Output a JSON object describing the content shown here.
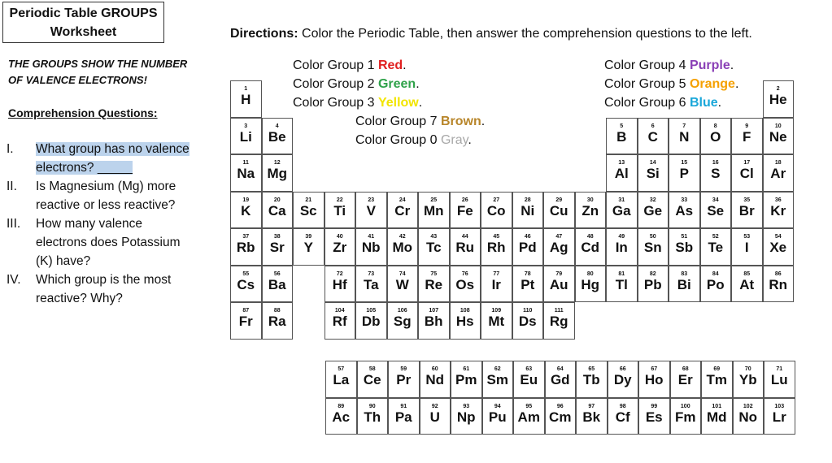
{
  "worksheet": {
    "title_line1": "Periodic Table GROUPS",
    "title_line2": "Worksheet",
    "directions_label": "Directions:",
    "directions_text": " Color the Periodic Table, then answer the comprehension questions to the left.",
    "caps_line1": "THE GROUPS SHOW THE NUMBER",
    "caps_line2": "OF VALENCE ELECTRONS!",
    "comprehension_title": "Comprehension Questions:"
  },
  "questions": [
    {
      "num": "I.",
      "text": "What group has no valence",
      "text2": "electrons? _____"
    },
    {
      "num": "II.",
      "text": "Is Magnesium (Mg) more",
      "text2": "reactive or less reactive?"
    },
    {
      "num": "III.",
      "text": "How many valence",
      "text2": "electrons does Potassium",
      "text3": "(K) have?"
    },
    {
      "num": "IV.",
      "text": "Which group is the most",
      "text2": "reactive?  Why?"
    }
  ],
  "color_instructions": {
    "col1": [
      {
        "prefix": "Color Group 1 ",
        "color": "Red",
        "hex": "#e02020"
      },
      {
        "prefix": "Color Group 2 ",
        "color": "Green",
        "hex": "#2fa24a"
      },
      {
        "prefix": "Color Group 3 ",
        "color": "Yellow",
        "hex": "#f2e500"
      }
    ],
    "col1b": [
      {
        "prefix": "Color Group 7 ",
        "color": "Brown",
        "hex": "#b8862b"
      },
      {
        "prefix": "Color Group 0 ",
        "color": "Gray",
        "hex": "#a8a8a8"
      }
    ],
    "col2": [
      {
        "prefix": "Color Group 4 ",
        "color": "Purple",
        "hex": "#8a3fb6"
      },
      {
        "prefix": "Color Group 5 ",
        "color": "Orange",
        "hex": "#f5a000"
      },
      {
        "prefix": "Color Group 6 ",
        "color": "Blue",
        "hex": "#1aa7d9"
      }
    ]
  },
  "elements": [
    {
      "s": "H",
      "n": "1",
      "r": 0,
      "c": 0
    },
    {
      "s": "He",
      "n": "2",
      "r": 0,
      "c": 17
    },
    {
      "s": "Li",
      "n": "3",
      "r": 1,
      "c": 0
    },
    {
      "s": "Be",
      "n": "4",
      "r": 1,
      "c": 1
    },
    {
      "s": "B",
      "n": "5",
      "r": 1,
      "c": 12
    },
    {
      "s": "C",
      "n": "6",
      "r": 1,
      "c": 13
    },
    {
      "s": "N",
      "n": "7",
      "r": 1,
      "c": 14
    },
    {
      "s": "O",
      "n": "8",
      "r": 1,
      "c": 15
    },
    {
      "s": "F",
      "n": "9",
      "r": 1,
      "c": 16
    },
    {
      "s": "Ne",
      "n": "10",
      "r": 1,
      "c": 17
    },
    {
      "s": "Na",
      "n": "11",
      "r": 2,
      "c": 0
    },
    {
      "s": "Mg",
      "n": "12",
      "r": 2,
      "c": 1
    },
    {
      "s": "Al",
      "n": "13",
      "r": 2,
      "c": 12
    },
    {
      "s": "Si",
      "n": "14",
      "r": 2,
      "c": 13
    },
    {
      "s": "P",
      "n": "15",
      "r": 2,
      "c": 14
    },
    {
      "s": "S",
      "n": "16",
      "r": 2,
      "c": 15
    },
    {
      "s": "Cl",
      "n": "17",
      "r": 2,
      "c": 16
    },
    {
      "s": "Ar",
      "n": "18",
      "r": 2,
      "c": 17
    },
    {
      "s": "K",
      "n": "19",
      "r": 3,
      "c": 0
    },
    {
      "s": "Ca",
      "n": "20",
      "r": 3,
      "c": 1
    },
    {
      "s": "Sc",
      "n": "21",
      "r": 3,
      "c": 2
    },
    {
      "s": "Ti",
      "n": "22",
      "r": 3,
      "c": 3
    },
    {
      "s": "V",
      "n": "23",
      "r": 3,
      "c": 4
    },
    {
      "s": "Cr",
      "n": "24",
      "r": 3,
      "c": 5
    },
    {
      "s": "Mn",
      "n": "25",
      "r": 3,
      "c": 6
    },
    {
      "s": "Fe",
      "n": "26",
      "r": 3,
      "c": 7
    },
    {
      "s": "Co",
      "n": "27",
      "r": 3,
      "c": 8
    },
    {
      "s": "Ni",
      "n": "28",
      "r": 3,
      "c": 9
    },
    {
      "s": "Cu",
      "n": "29",
      "r": 3,
      "c": 10
    },
    {
      "s": "Zn",
      "n": "30",
      "r": 3,
      "c": 11
    },
    {
      "s": "Ga",
      "n": "31",
      "r": 3,
      "c": 12
    },
    {
      "s": "Ge",
      "n": "32",
      "r": 3,
      "c": 13
    },
    {
      "s": "As",
      "n": "33",
      "r": 3,
      "c": 14
    },
    {
      "s": "Se",
      "n": "34",
      "r": 3,
      "c": 15
    },
    {
      "s": "Br",
      "n": "35",
      "r": 3,
      "c": 16
    },
    {
      "s": "Kr",
      "n": "36",
      "r": 3,
      "c": 17
    },
    {
      "s": "Rb",
      "n": "37",
      "r": 4,
      "c": 0
    },
    {
      "s": "Sr",
      "n": "38",
      "r": 4,
      "c": 1
    },
    {
      "s": "Y",
      "n": "39",
      "r": 4,
      "c": 2
    },
    {
      "s": "Zr",
      "n": "40",
      "r": 4,
      "c": 3
    },
    {
      "s": "Nb",
      "n": "41",
      "r": 4,
      "c": 4
    },
    {
      "s": "Mo",
      "n": "42",
      "r": 4,
      "c": 5
    },
    {
      "s": "Tc",
      "n": "43",
      "r": 4,
      "c": 6
    },
    {
      "s": "Ru",
      "n": "44",
      "r": 4,
      "c": 7
    },
    {
      "s": "Rh",
      "n": "45",
      "r": 4,
      "c": 8
    },
    {
      "s": "Pd",
      "n": "46",
      "r": 4,
      "c": 9
    },
    {
      "s": "Ag",
      "n": "47",
      "r": 4,
      "c": 10
    },
    {
      "s": "Cd",
      "n": "48",
      "r": 4,
      "c": 11
    },
    {
      "s": "In",
      "n": "49",
      "r": 4,
      "c": 12
    },
    {
      "s": "Sn",
      "n": "50",
      "r": 4,
      "c": 13
    },
    {
      "s": "Sb",
      "n": "51",
      "r": 4,
      "c": 14
    },
    {
      "s": "Te",
      "n": "52",
      "r": 4,
      "c": 15
    },
    {
      "s": "I",
      "n": "53",
      "r": 4,
      "c": 16
    },
    {
      "s": "Xe",
      "n": "54",
      "r": 4,
      "c": 17
    },
    {
      "s": "Cs",
      "n": "55",
      "r": 5,
      "c": 0
    },
    {
      "s": "Ba",
      "n": "56",
      "r": 5,
      "c": 1
    },
    {
      "s": "Hf",
      "n": "72",
      "r": 5,
      "c": 3
    },
    {
      "s": "Ta",
      "n": "73",
      "r": 5,
      "c": 4
    },
    {
      "s": "W",
      "n": "74",
      "r": 5,
      "c": 5
    },
    {
      "s": "Re",
      "n": "75",
      "r": 5,
      "c": 6
    },
    {
      "s": "Os",
      "n": "76",
      "r": 5,
      "c": 7
    },
    {
      "s": "Ir",
      "n": "77",
      "r": 5,
      "c": 8
    },
    {
      "s": "Pt",
      "n": "78",
      "r": 5,
      "c": 9
    },
    {
      "s": "Au",
      "n": "79",
      "r": 5,
      "c": 10
    },
    {
      "s": "Hg",
      "n": "80",
      "r": 5,
      "c": 11
    },
    {
      "s": "Tl",
      "n": "81",
      "r": 5,
      "c": 12
    },
    {
      "s": "Pb",
      "n": "82",
      "r": 5,
      "c": 13
    },
    {
      "s": "Bi",
      "n": "83",
      "r": 5,
      "c": 14
    },
    {
      "s": "Po",
      "n": "84",
      "r": 5,
      "c": 15
    },
    {
      "s": "At",
      "n": "85",
      "r": 5,
      "c": 16
    },
    {
      "s": "Rn",
      "n": "86",
      "r": 5,
      "c": 17
    },
    {
      "s": "Fr",
      "n": "87",
      "r": 6,
      "c": 0
    },
    {
      "s": "Ra",
      "n": "88",
      "r": 6,
      "c": 1
    },
    {
      "s": "Rf",
      "n": "104",
      "r": 6,
      "c": 3
    },
    {
      "s": "Db",
      "n": "105",
      "r": 6,
      "c": 4
    },
    {
      "s": "Sg",
      "n": "106",
      "r": 6,
      "c": 5
    },
    {
      "s": "Bh",
      "n": "107",
      "r": 6,
      "c": 6
    },
    {
      "s": "Hs",
      "n": "108",
      "r": 6,
      "c": 7
    },
    {
      "s": "Mt",
      "n": "109",
      "r": 6,
      "c": 8
    },
    {
      "s": "Ds",
      "n": "110",
      "r": 6,
      "c": 9
    },
    {
      "s": "Rg",
      "n": "111",
      "r": 6,
      "c": 10
    }
  ],
  "f_elements": [
    {
      "s": "La",
      "n": "57",
      "r": 0,
      "c": 0
    },
    {
      "s": "Ce",
      "n": "58",
      "r": 0,
      "c": 1
    },
    {
      "s": "Pr",
      "n": "59",
      "r": 0,
      "c": 2
    },
    {
      "s": "Nd",
      "n": "60",
      "r": 0,
      "c": 3
    },
    {
      "s": "Pm",
      "n": "61",
      "r": 0,
      "c": 4
    },
    {
      "s": "Sm",
      "n": "62",
      "r": 0,
      "c": 5
    },
    {
      "s": "Eu",
      "n": "63",
      "r": 0,
      "c": 6
    },
    {
      "s": "Gd",
      "n": "64",
      "r": 0,
      "c": 7
    },
    {
      "s": "Tb",
      "n": "65",
      "r": 0,
      "c": 8
    },
    {
      "s": "Dy",
      "n": "66",
      "r": 0,
      "c": 9
    },
    {
      "s": "Ho",
      "n": "67",
      "r": 0,
      "c": 10
    },
    {
      "s": "Er",
      "n": "68",
      "r": 0,
      "c": 11
    },
    {
      "s": "Tm",
      "n": "69",
      "r": 0,
      "c": 12
    },
    {
      "s": "Yb",
      "n": "70",
      "r": 0,
      "c": 13
    },
    {
      "s": "Lu",
      "n": "71",
      "r": 0,
      "c": 14
    },
    {
      "s": "Ac",
      "n": "89",
      "r": 1,
      "c": 0
    },
    {
      "s": "Th",
      "n": "90",
      "r": 1,
      "c": 1
    },
    {
      "s": "Pa",
      "n": "91",
      "r": 1,
      "c": 2
    },
    {
      "s": "U",
      "n": "92",
      "r": 1,
      "c": 3
    },
    {
      "s": "Np",
      "n": "93",
      "r": 1,
      "c": 4
    },
    {
      "s": "Pu",
      "n": "94",
      "r": 1,
      "c": 5
    },
    {
      "s": "Am",
      "n": "95",
      "r": 1,
      "c": 6
    },
    {
      "s": "Cm",
      "n": "96",
      "r": 1,
      "c": 7
    },
    {
      "s": "Bk",
      "n": "97",
      "r": 1,
      "c": 8
    },
    {
      "s": "Cf",
      "n": "98",
      "r": 1,
      "c": 9
    },
    {
      "s": "Es",
      "n": "99",
      "r": 1,
      "c": 10
    },
    {
      "s": "Fm",
      "n": "100",
      "r": 1,
      "c": 11
    },
    {
      "s": "Md",
      "n": "101",
      "r": 1,
      "c": 12
    },
    {
      "s": "No",
      "n": "102",
      "r": 1,
      "c": 13
    },
    {
      "s": "Lr",
      "n": "103",
      "r": 1,
      "c": 14
    }
  ]
}
